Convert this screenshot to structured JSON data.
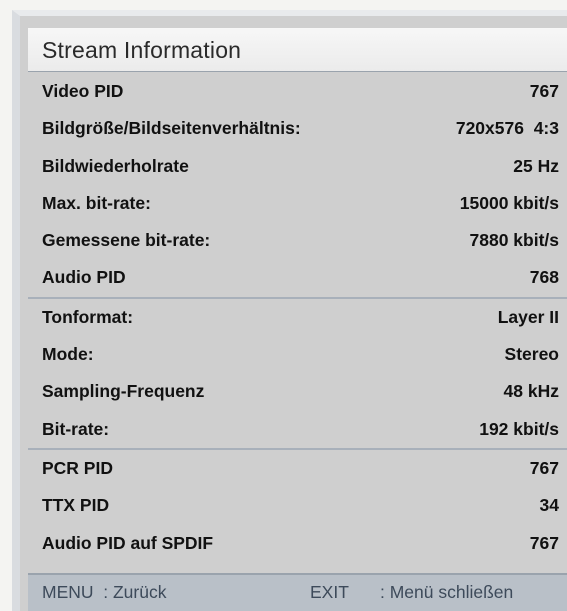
{
  "title": "Stream Information",
  "groups": [
    {
      "rows": [
        {
          "label": "Video PID",
          "value": "767"
        },
        {
          "label": "Bildgröße/Bildseitenverhältnis:",
          "value": "720x576  4:3"
        },
        {
          "label": "Bildwiederholrate",
          "value": "25 Hz"
        },
        {
          "label": "Max. bit-rate:",
          "value": "15000 kbit/s"
        },
        {
          "label": "Gemessene bit-rate:",
          "value": "7880 kbit/s"
        },
        {
          "label": "Audio PID",
          "value": "768"
        }
      ]
    },
    {
      "rows": [
        {
          "label": "Tonformat:",
          "value": "Layer II"
        },
        {
          "label": "Mode:",
          "value": "Stereo"
        },
        {
          "label": "Sampling-Frequenz",
          "value": "48 kHz"
        },
        {
          "label": "Bit-rate:",
          "value": "192 kbit/s"
        }
      ]
    },
    {
      "rows": [
        {
          "label": "PCR PID",
          "value": "767"
        },
        {
          "label": "TTX PID",
          "value": "34"
        },
        {
          "label": "Audio PID auf SPDIF",
          "value": "767"
        }
      ]
    }
  ],
  "footer": {
    "menu_hint": "MENU  : Zurück",
    "exit_key": "EXIT",
    "exit_hint": ": Menü schließen"
  }
}
